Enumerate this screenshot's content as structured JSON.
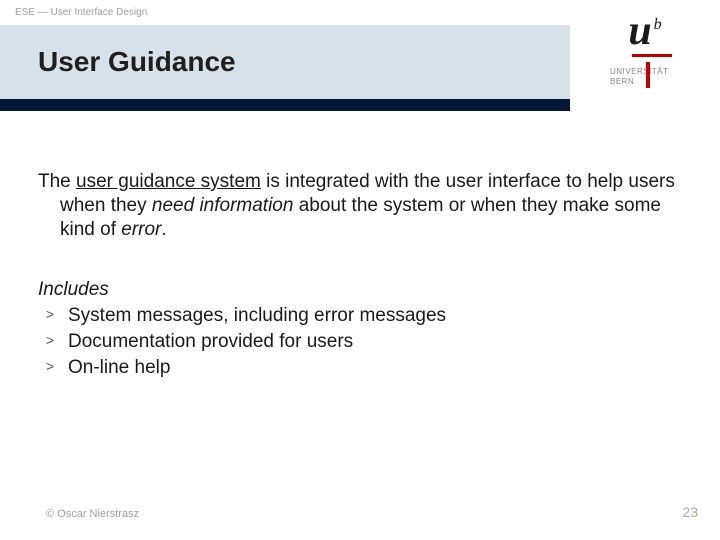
{
  "header": {
    "breadcrumb": "ESE — User Interface Design",
    "title": "User Guidance"
  },
  "logo": {
    "u": "u",
    "b": "b",
    "line1": "UNIVERSITÄT",
    "line2": "BERN"
  },
  "body": {
    "para_lead": "The ",
    "para_ugs": "user guidance system",
    "para_after_ugs": " is integrated with the user interface to help users when they ",
    "para_need_info": "need information",
    "para_after_need": " about the system or when they make some kind of ",
    "para_error": "error",
    "para_tail": "."
  },
  "includes": {
    "heading": "Includes",
    "bullet_char": ">",
    "items": [
      "System messages, including error messages",
      "Documentation provided for users",
      "On-line help"
    ]
  },
  "footer": {
    "copyright": "© Oscar Nierstrasz",
    "page": "23"
  }
}
